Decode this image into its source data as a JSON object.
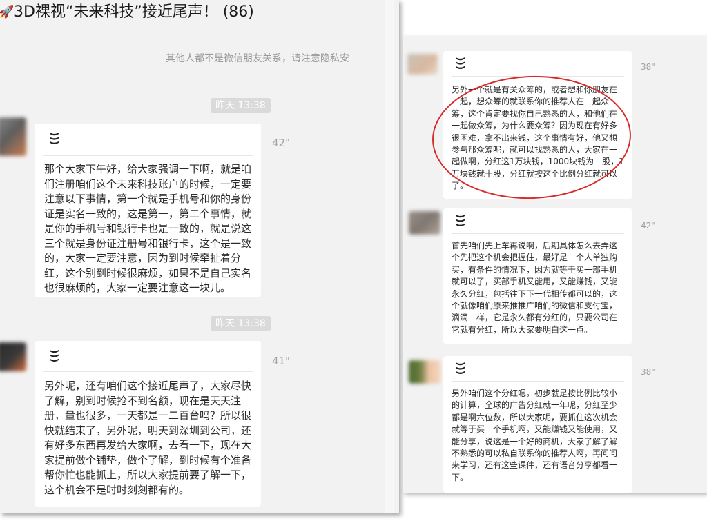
{
  "chat": {
    "title": "3D裸视“未来科技”接近尾声！ (86)",
    "title_icon": "rocket-icon",
    "notice": "其他人都不是微信朋友关系，请注意隐私安"
  },
  "colors": {
    "panel_bg": "#f2f2f2",
    "bubble_bg": "#ffffff",
    "timestamp_bg": "#dadada",
    "annotation": "#d82a2a"
  },
  "left_messages": [
    {
      "time": "昨天 13:38",
      "duration": "42\"",
      "text": "那个大家下午好，给大家强调一下啊，就是咱们注册咱们这个未来科技账户的时候，一定要注意以下事情，第一个就是手机号和你的身份证是实名一致的，这是第一，第二个事情，就是你的手机号和银行卡也是一致的，就是说这三个就是身份证注册号和银行卡，这个是一致的，大家一定要注意，因为到时候牵扯着分红，这个别到时候很麻烦，如果不是自己实名也很麻烦的，大家一定要注意这一块儿。"
    },
    {
      "time": "昨天 13:38",
      "duration": "41\"",
      "text": "另外呢，还有咱们这个接近尾声了，大家尽快了解，别到时候抢不到名额，现在是天天注册，量也很多，一天都是一二百台吗？所以很快就结束了，另外呢，明天到深圳到公司，还有好多东西再发给大家啊，去看一下，现在大家提前做个铺垫，做个了解，到时候有个准备帮你忙也能抓上，所以大家提前要了解一下，这个机会不是时时刻刻都有的。"
    }
  ],
  "right_messages": [
    {
      "duration": "38\"",
      "text": "另外一个就是有关众筹的，或者想和你朋友在一起，想众筹的就联系你的推荐人在一起众筹，这个肯定要找你自己熟悉的人，和他们在一起做众筹，为什么要众筹？因为现在有好多很困难，拿不出来钱，这个事情有好，他又想参与那众筹呢，就可以找熟悉的人，大家在一起做啊，分红这1万块钱，1000块钱为一股，1万块钱就十股，分红就按这个比例分红就可以了。"
    },
    {
      "duration": "42\"",
      "text": "首先咱们先上车再说啊，后期具体怎么去弄这个先把这个机会把握住，最好是一个人单独购买，有条件的情况下，因为就等于买一部手机就可以了，买部手机又能用，又能赚钱，又能永久分红，包括往下下一代相传都可以的，这个就像咱们原来推推广咱们的微信和支付宝，滴滴一样，它是永久都有分红的，只要公司在它就有分红，所以大家要明白这一点。"
    },
    {
      "duration": "38\"",
      "text": "另外咱们这个分红嗯，初步就是按比例比较小的计算，全球的广告分红就一年呢，分红至少都是啊六位数，所以大家呢，要抓住这次机会就等于买一个手机啊，又能赚钱又能使用，又能分享，说这是一个好的商机，大家了解了解不熟悉的可以私自联系你的推荐人啊，再问问来学习，还有这些课件，还有语音分享都看一下。"
    }
  ]
}
